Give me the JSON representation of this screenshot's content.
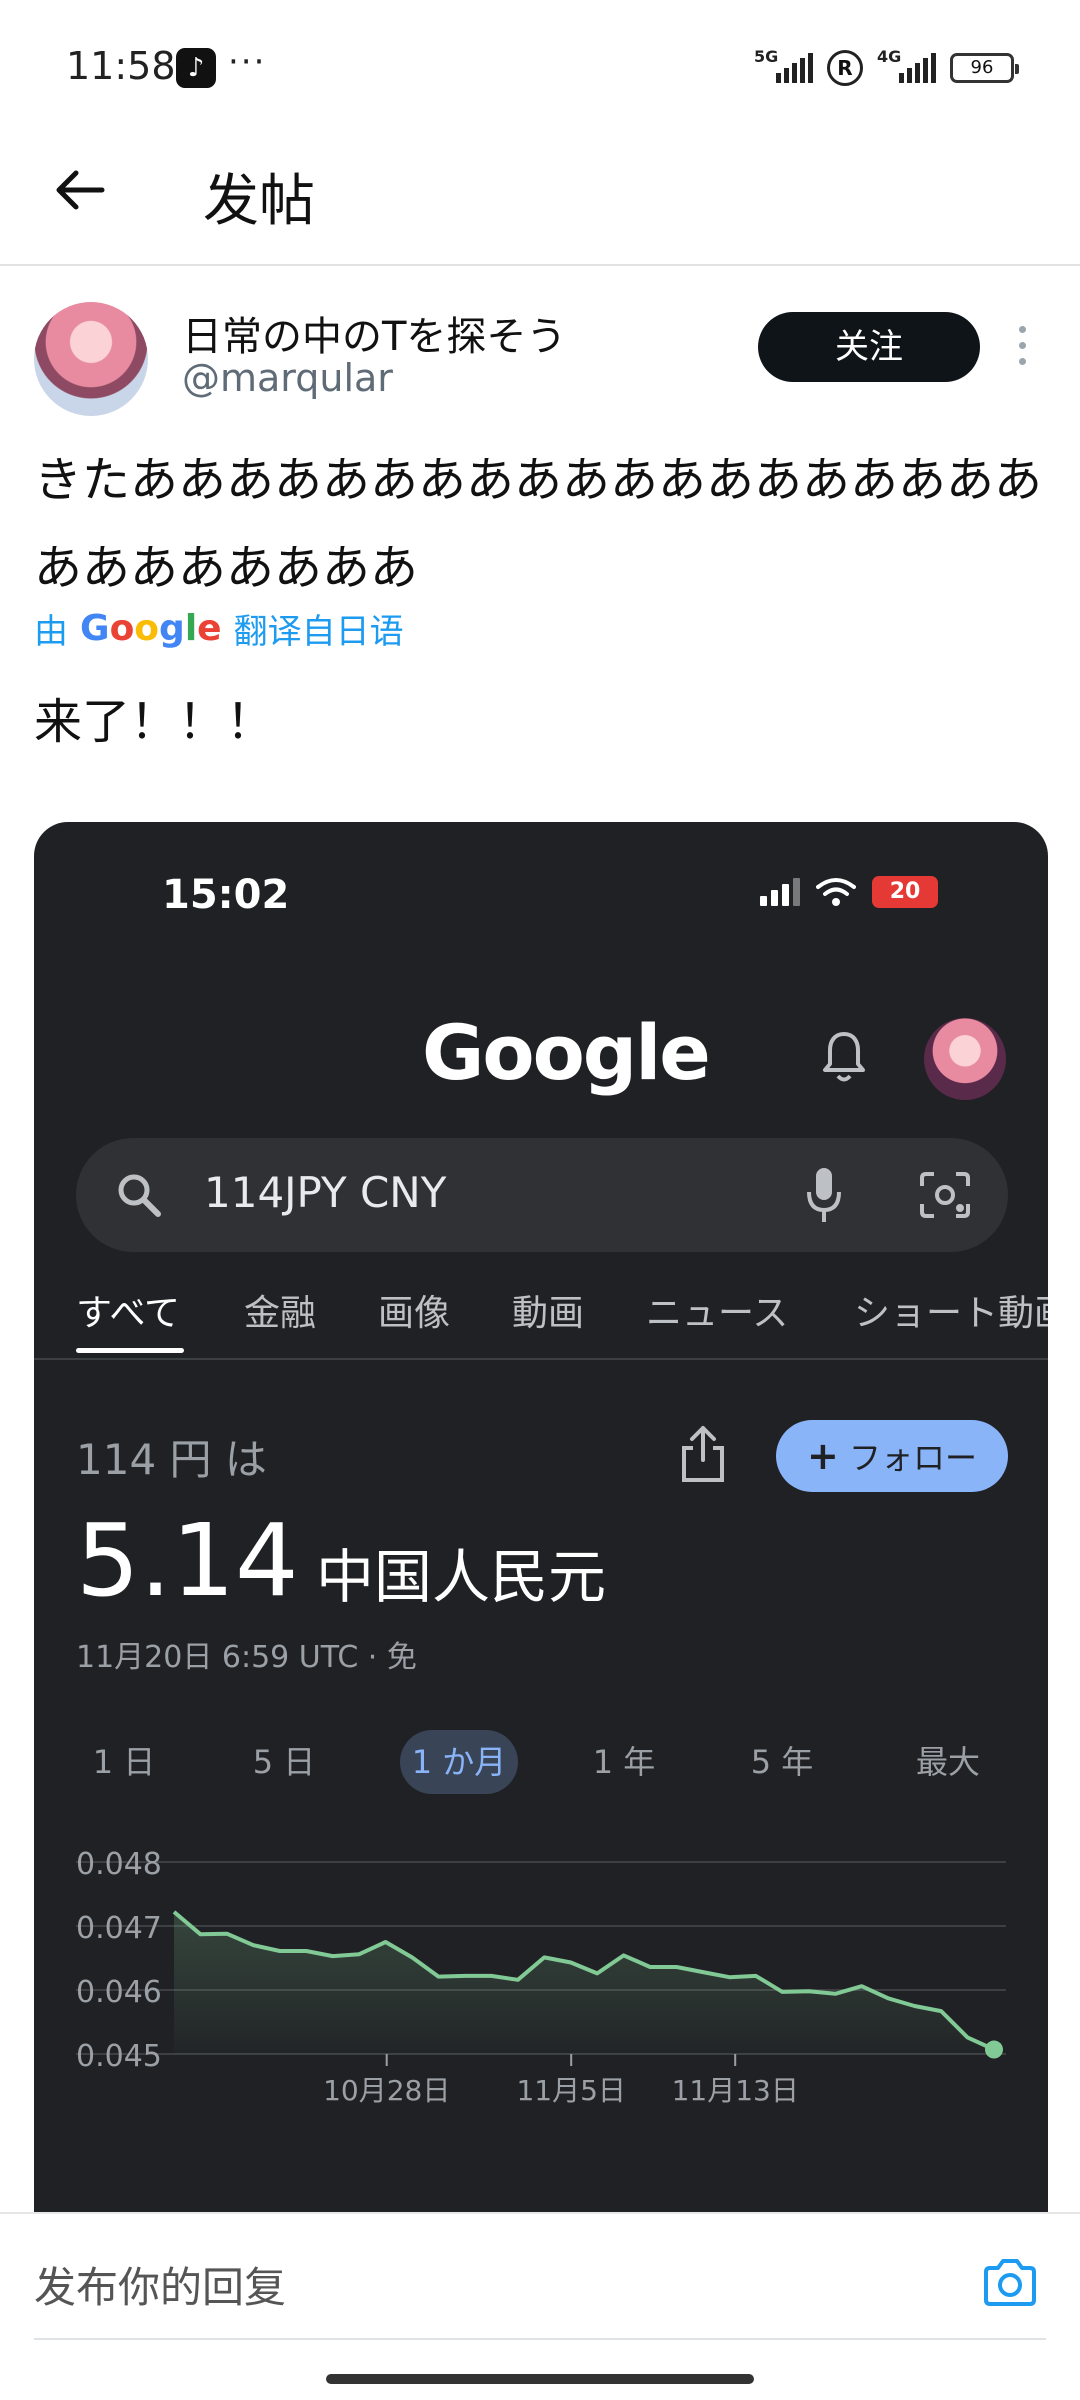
{
  "status_bar": {
    "time": "11:58",
    "app_icon": "tiktok-icon",
    "more": "···",
    "network_1": "5G",
    "network_2": "4G",
    "roaming": "R",
    "battery": "96"
  },
  "header": {
    "back_icon": "arrow-left-icon",
    "title": "发帖"
  },
  "post": {
    "display_name": "日常の中のTを探そう",
    "handle": "@marqular",
    "follow_label": "关注",
    "original_text": "きたあああああああああああああああああああああああああああ",
    "translated_prefix": "由",
    "translated_brand": "Google",
    "translated_suffix": "翻译自日语",
    "translated_text": "来了！！！"
  },
  "embedded_screenshot": {
    "time": "15:02",
    "battery": "20",
    "logo": "Google",
    "search_query": "114JPY CNY",
    "tabs": [
      "すべて",
      "金融",
      "画像",
      "動画",
      "ニュース",
      "ショート動画"
    ],
    "amount_text": "114 円 は",
    "follow_label": "フォロー",
    "converted_value": "5.14",
    "converted_currency": "中国人民元",
    "updated_text": "11月20日 6:59 UTC · 免",
    "ranges": [
      "1 日",
      "5 日",
      "1 か月",
      "1 年",
      "5 年",
      "最大"
    ],
    "active_range": "1 か月",
    "colors": {
      "background": "#202124",
      "line": "#81c995",
      "accent": "#8ab4f8"
    }
  },
  "chart_data": {
    "type": "area",
    "ylim": [
      0.045,
      0.048
    ],
    "y_ticks": [
      "0.048",
      "0.047",
      "0.046",
      "0.045"
    ],
    "x_tick_labels": [
      "10月28日",
      "11月5日",
      "11月13日"
    ],
    "grid": true,
    "values": [
      0.04722,
      0.04687,
      0.04688,
      0.0467,
      0.04661,
      0.04661,
      0.04653,
      0.04656,
      0.04675,
      0.04651,
      0.04621,
      0.04622,
      0.04622,
      0.04616,
      0.04651,
      0.04643,
      0.04626,
      0.04654,
      0.04636,
      0.04636,
      0.04628,
      0.0462,
      0.04622,
      0.04597,
      0.04598,
      0.04594,
      0.04606,
      0.04587,
      0.04575,
      0.04567,
      0.04526,
      0.04507
    ],
    "line_color": "#81c995"
  },
  "reply_bar": {
    "placeholder": "发布你的回复",
    "camera_icon": "camera-icon"
  }
}
